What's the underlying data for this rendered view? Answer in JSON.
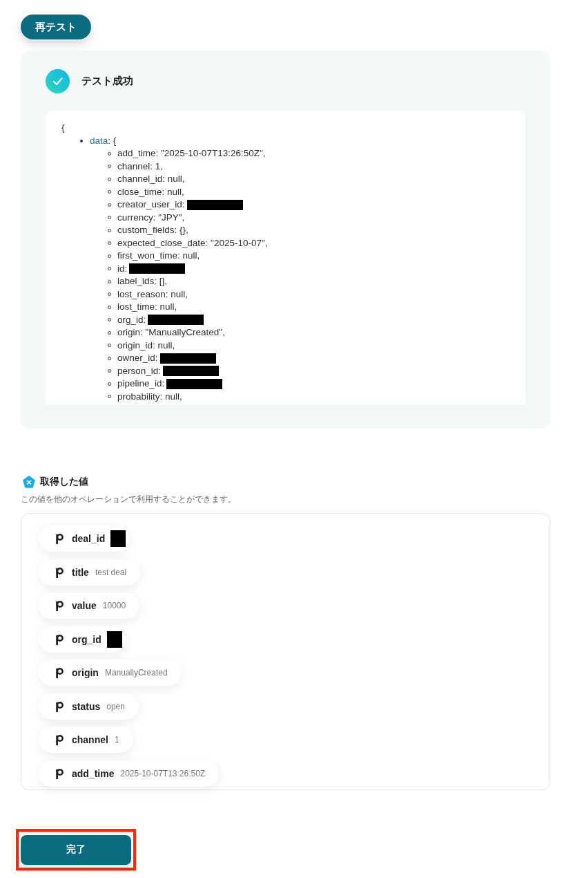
{
  "retest_button": {
    "label": "再テスト"
  },
  "test_result": {
    "passed": true,
    "title": "テスト成功",
    "output": {
      "open_brace": "{",
      "root_key": "data",
      "root_rest": ": {",
      "fields": [
        {
          "text": "add_time: \"2025-10-07T13:26:50Z\",",
          "redacted": false
        },
        {
          "text": "channel: 1,",
          "redacted": false
        },
        {
          "text": "channel_id: null,",
          "redacted": false
        },
        {
          "text": "close_time: null,",
          "redacted": false
        },
        {
          "text": "creator_user_id:",
          "redacted": true
        },
        {
          "text": "currency: \"JPY\",",
          "redacted": false
        },
        {
          "text": "custom_fields: {},",
          "redacted": false
        },
        {
          "text": "expected_close_date: \"2025-10-07\",",
          "redacted": false
        },
        {
          "text": "first_won_time: null,",
          "redacted": false
        },
        {
          "text": "id:",
          "redacted": true
        },
        {
          "text": "label_ids: [],",
          "redacted": false
        },
        {
          "text": "lost_reason: null,",
          "redacted": false
        },
        {
          "text": "lost_time: null,",
          "redacted": false
        },
        {
          "text": "org_id:",
          "redacted": true
        },
        {
          "text": "origin: \"ManuallyCreated\",",
          "redacted": false
        },
        {
          "text": "origin_id: null,",
          "redacted": false
        },
        {
          "text": "owner_id:",
          "redacted": true
        },
        {
          "text": "person_id:",
          "redacted": true
        },
        {
          "text": "pipeline_id:",
          "redacted": true
        },
        {
          "text": "probability: null,",
          "redacted": false
        }
      ]
    }
  },
  "retrieved_values": {
    "title": "取得した値",
    "description": "この値を他のオペレーションで利用することができます。",
    "items": [
      {
        "name": "deal_id",
        "redacted": true
      },
      {
        "name": "title",
        "value": "test deal",
        "redacted": false
      },
      {
        "name": "value",
        "value": "10000",
        "redacted": false
      },
      {
        "name": "org_id",
        "redacted": true
      },
      {
        "name": "origin",
        "value": "ManuallyCreated",
        "redacted": false
      },
      {
        "name": "status",
        "value": "open",
        "redacted": false
      },
      {
        "name": "channel",
        "value": "1",
        "redacted": false
      },
      {
        "name": "add_time",
        "value": "2025-10-07T13:26:50Z",
        "redacted": false
      }
    ]
  },
  "done_button": {
    "label": "完了",
    "highlighted": true
  }
}
